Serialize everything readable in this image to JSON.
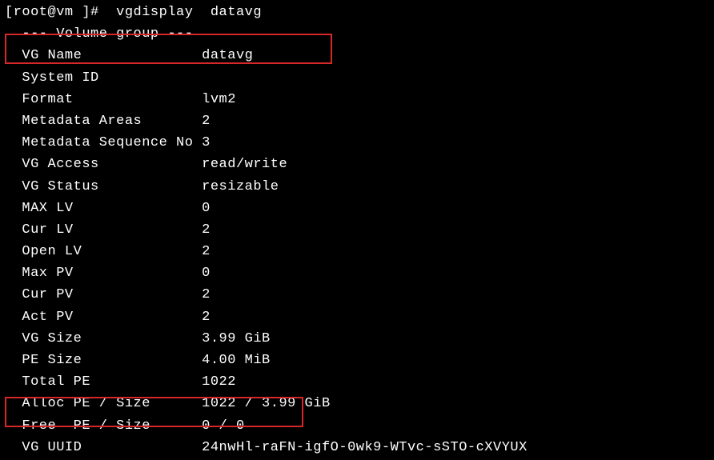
{
  "prompt": {
    "user_host": "[root@vm ]# ",
    "command": " vgdisplay  datavg"
  },
  "output": {
    "header": "  --- Volume group ---",
    "rows": [
      {
        "label": "  VG Name              ",
        "value": "datavg"
      },
      {
        "label": "  System ID            ",
        "value": ""
      },
      {
        "label": "  Format               ",
        "value": "lvm2"
      },
      {
        "label": "  Metadata Areas       ",
        "value": "2"
      },
      {
        "label": "  Metadata Sequence No ",
        "value": "3"
      },
      {
        "label": "  VG Access            ",
        "value": "read/write"
      },
      {
        "label": "  VG Status            ",
        "value": "resizable"
      },
      {
        "label": "  MAX LV               ",
        "value": "0"
      },
      {
        "label": "  Cur LV               ",
        "value": "2"
      },
      {
        "label": "  Open LV              ",
        "value": "2"
      },
      {
        "label": "  Max PV               ",
        "value": "0"
      },
      {
        "label": "  Cur PV               ",
        "value": "2"
      },
      {
        "label": "  Act PV               ",
        "value": "2"
      },
      {
        "label": "  VG Size              ",
        "value": "3.99 GiB"
      },
      {
        "label": "  PE Size              ",
        "value": "4.00 MiB"
      },
      {
        "label": "  Total PE             ",
        "value": "1022"
      },
      {
        "label": "  Alloc PE / Size      ",
        "value": "1022 / 3.99 GiB"
      },
      {
        "label": "  Free  PE / Size      ",
        "value": "0 / 0"
      },
      {
        "label": "  VG UUID              ",
        "value": "24nwHl-raFN-igfO-0wk9-WTvc-sSTO-cXVYUX"
      }
    ]
  },
  "highlights": {
    "hl1_target": "VG Name row",
    "hl2_target": "Free PE / Size row"
  }
}
